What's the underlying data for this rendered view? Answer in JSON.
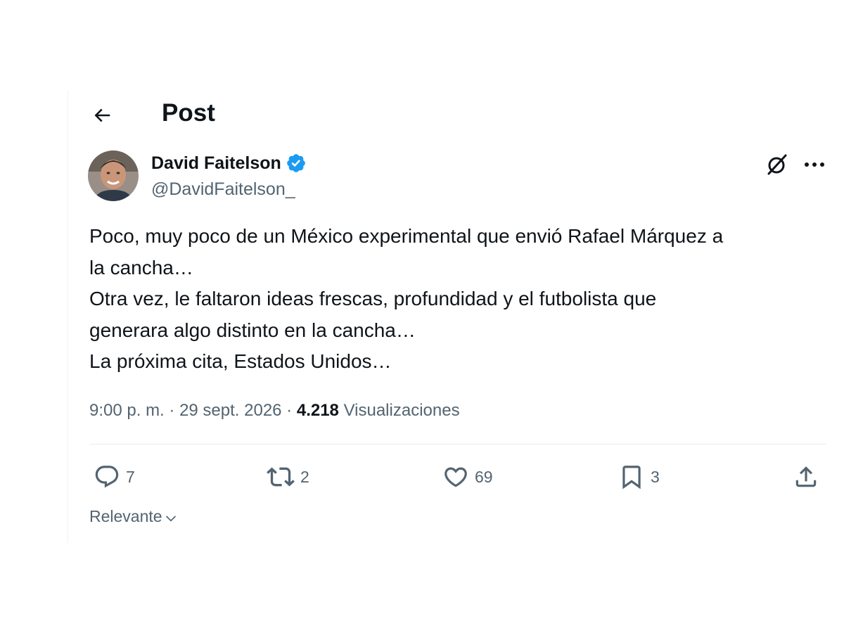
{
  "header": {
    "back_icon": "arrow-left-icon",
    "title": "Post"
  },
  "author": {
    "display_name": "David Faitelson",
    "handle": "@DavidFaitelson_",
    "verified": true,
    "verified_color": "#1d9bf0"
  },
  "tweet": {
    "lines": [
      "Poco, muy poco de un México experimental que envió Rafael Márquez a",
      "la cancha…",
      "Otra vez, le faltaron ideas frescas, profundidad y el futbolista que",
      "generara algo distinto en la cancha…",
      "La próxima cita, Estados Unidos…"
    ]
  },
  "meta": {
    "time": "9:00 p. m.",
    "separator": " · ",
    "date": "29 sept. 2026",
    "views_count": "4.218",
    "views_label": " Visualizaciones"
  },
  "actions": {
    "replies": "7",
    "reposts": "2",
    "likes": "69",
    "bookmarks": "3",
    "icons": [
      "reply-icon",
      "repost-icon",
      "like-icon",
      "bookmark-icon",
      "share-icon"
    ]
  },
  "sort": {
    "label": "Relevante",
    "icon": "chevron-down-icon"
  },
  "colors": {
    "text": "#0f1419",
    "secondary": "#536471",
    "divider": "#e6ecf0"
  }
}
